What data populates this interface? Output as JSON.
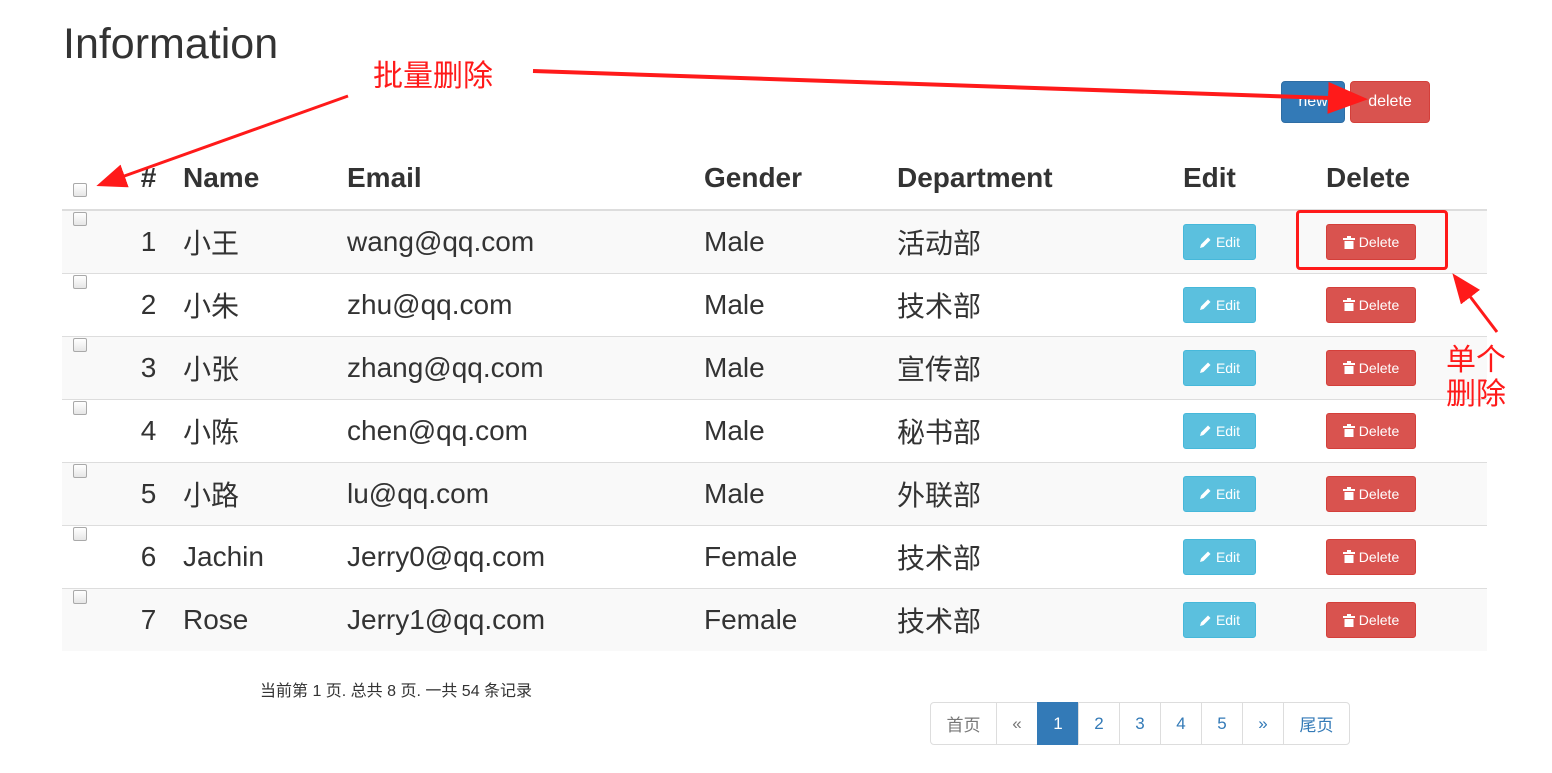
{
  "page": {
    "title": "Information"
  },
  "toolbar": {
    "new_label": "new",
    "delete_label": "delete"
  },
  "table": {
    "headers": {
      "num": "#",
      "name": "Name",
      "email": "Email",
      "gender": "Gender",
      "department": "Department",
      "edit": "Edit",
      "delete": "Delete"
    },
    "rows": [
      {
        "num": "1",
        "name": "小王",
        "email": "wang@qq.com",
        "gender": "Male",
        "department": "活动部"
      },
      {
        "num": "2",
        "name": "小朱",
        "email": "zhu@qq.com",
        "gender": "Male",
        "department": "技术部"
      },
      {
        "num": "3",
        "name": "小张",
        "email": "zhang@qq.com",
        "gender": "Male",
        "department": "宣传部"
      },
      {
        "num": "4",
        "name": "小陈",
        "email": "chen@qq.com",
        "gender": "Male",
        "department": "秘书部"
      },
      {
        "num": "5",
        "name": "小路",
        "email": "lu@qq.com",
        "gender": "Male",
        "department": "外联部"
      },
      {
        "num": "6",
        "name": "Jachin",
        "email": "Jerry0@qq.com",
        "gender": "Female",
        "department": "技术部"
      },
      {
        "num": "7",
        "name": "Rose",
        "email": "Jerry1@qq.com",
        "gender": "Female",
        "department": "技术部"
      }
    ],
    "row_edit_label": "Edit",
    "row_delete_label": "Delete"
  },
  "annotations": {
    "bulk_delete": "批量删除",
    "single_delete": "单个删除"
  },
  "footer": {
    "page_info": "当前第 1 页. 总共 8 页. 一共 54 条记录",
    "pagination": {
      "first": "首页",
      "prev": "«",
      "pages": [
        "1",
        "2",
        "3",
        "4",
        "5"
      ],
      "active_page": "1",
      "next": "»",
      "last": "尾页"
    }
  },
  "colors": {
    "primary": "#337ab7",
    "danger": "#d9534f",
    "info": "#5bc0de",
    "annotation": "#ff1a1a"
  },
  "icons": {
    "edit": "pencil-icon",
    "delete": "trash-icon"
  }
}
